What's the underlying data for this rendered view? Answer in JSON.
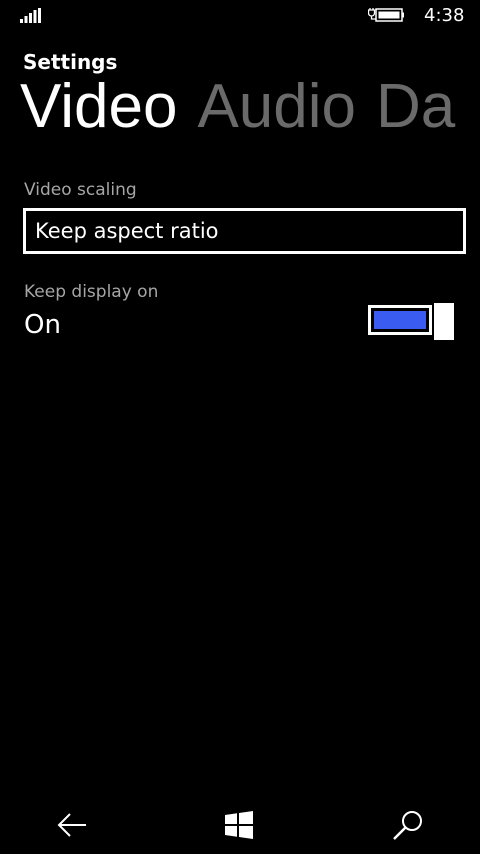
{
  "status_bar": {
    "time": "4:38",
    "signal_icon": "signal-strength-icon",
    "battery_icon": "battery-charging-icon"
  },
  "header": {
    "app_title": "Settings",
    "tabs": [
      {
        "label": "Video",
        "active": true
      },
      {
        "label": "Audio",
        "active": false
      },
      {
        "label": "Da",
        "active": false
      }
    ]
  },
  "video_scaling": {
    "label": "Video scaling",
    "value": "Keep aspect ratio"
  },
  "keep_display_on": {
    "label": "Keep display on",
    "state_text": "On",
    "enabled": true
  },
  "colors": {
    "background": "#000000",
    "accent": "#3a5cf0",
    "secondary_text": "#a6a6a6",
    "inactive_tab": "#6a6a6a"
  },
  "nav_bar": {
    "back_icon": "back-arrow-icon",
    "start_icon": "windows-logo-icon",
    "search_icon": "search-icon"
  }
}
